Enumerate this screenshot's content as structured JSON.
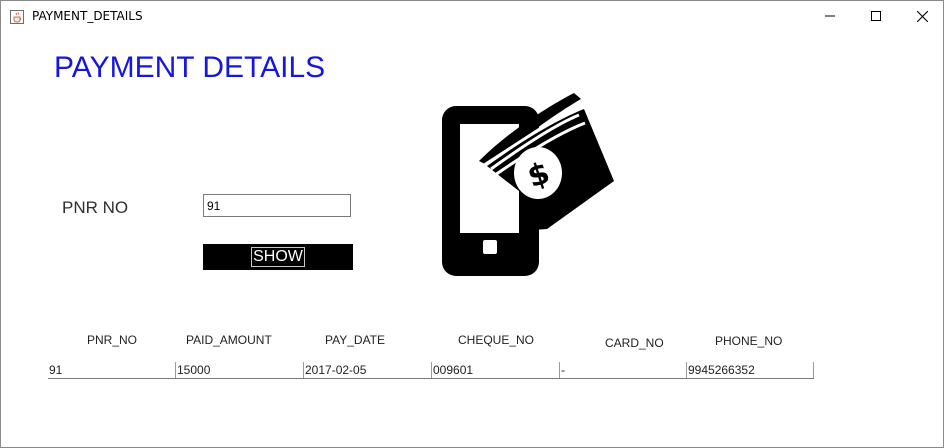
{
  "window": {
    "title": "PAYMENT_DETAILS",
    "controls": {
      "minimize": "—",
      "maximize": "☐",
      "close": "✕"
    }
  },
  "page": {
    "heading": "PAYMENT DETAILS",
    "heading_color": "#1616dd"
  },
  "form": {
    "pnr_label": "PNR NO",
    "pnr_value": "91",
    "show_label": "SHOW"
  },
  "table": {
    "headers": [
      "PNR_NO",
      "PAID_AMOUNT",
      "PAY_DATE",
      "CHEQUE_NO",
      "CARD_NO",
      "PHONE_NO"
    ],
    "rows": [
      [
        "91",
        "15000",
        "2017-02-05",
        "009601",
        "-",
        "9945266352"
      ]
    ]
  },
  "icons": {
    "app": "java-coffee-icon",
    "illustration": "mobile-payment-icon"
  }
}
